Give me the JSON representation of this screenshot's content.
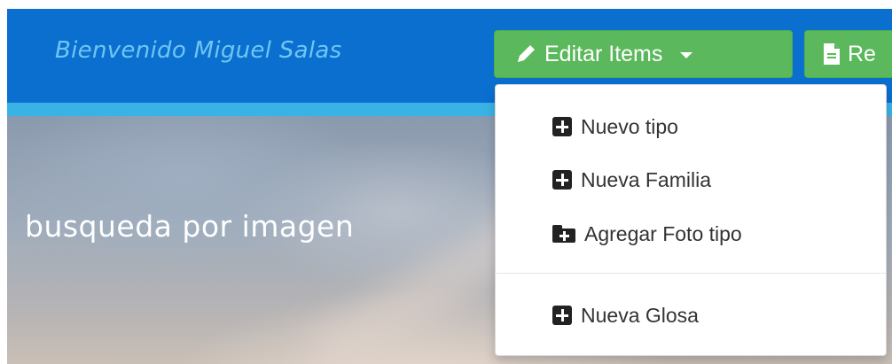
{
  "navbar": {
    "welcome_text": "Bienvenido Miguel Salas",
    "colors": {
      "bar": "#0b6fd0",
      "strip": "#39b3e6",
      "button": "#5cb85c"
    },
    "edit_button": {
      "label": "Editar Items",
      "icon": "pencil-icon",
      "has_caret": true
    },
    "report_button": {
      "label": "Re",
      "icon": "file-icon"
    }
  },
  "hero": {
    "text": "busqueda por imagen"
  },
  "dropdown": {
    "items": [
      {
        "label": "Nuevo tipo",
        "icon": "plus-square-icon"
      },
      {
        "label": "Nueva Familia",
        "icon": "plus-square-icon"
      },
      {
        "label": "Agregar Foto tipo",
        "icon": "folder-plus-icon"
      },
      {
        "label": "Nueva Glosa",
        "icon": "plus-square-icon"
      }
    ]
  }
}
